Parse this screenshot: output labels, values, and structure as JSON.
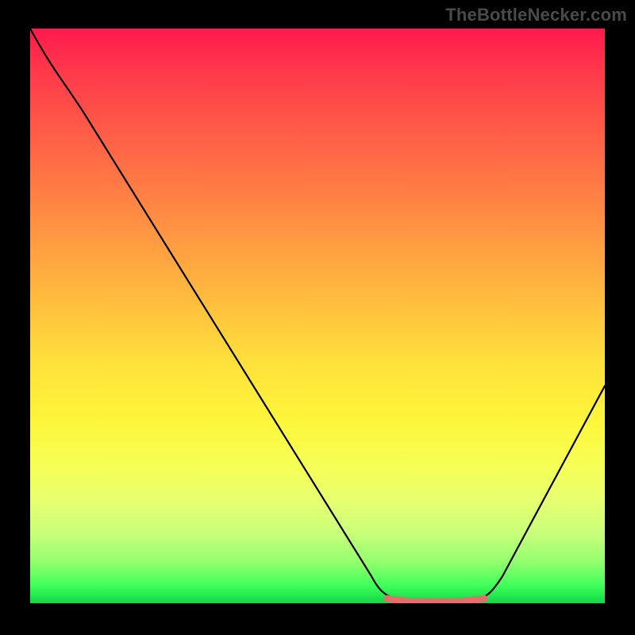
{
  "watermark": "TheBottleNecker.com",
  "colors": {
    "highlight": "#e56d6d",
    "line": "#000000",
    "background": "#000000"
  },
  "chart_data": {
    "type": "line",
    "title": "",
    "xlabel": "",
    "ylabel": "",
    "xlim": [
      0,
      100
    ],
    "ylim": [
      0,
      100
    ],
    "series": [
      {
        "name": "curve",
        "x": [
          0,
          5,
          10,
          15,
          20,
          25,
          30,
          35,
          40,
          45,
          50,
          55,
          60,
          62,
          66,
          72,
          78,
          80,
          84,
          88,
          92,
          96,
          100
        ],
        "y": [
          100,
          94,
          87,
          78,
          70,
          62,
          54,
          46,
          38,
          30,
          22,
          14,
          6,
          3,
          1,
          1,
          1,
          2,
          6,
          14,
          22,
          30,
          38
        ]
      }
    ],
    "highlight_range": {
      "x_start": 62,
      "x_end": 80
    },
    "annotations": []
  }
}
